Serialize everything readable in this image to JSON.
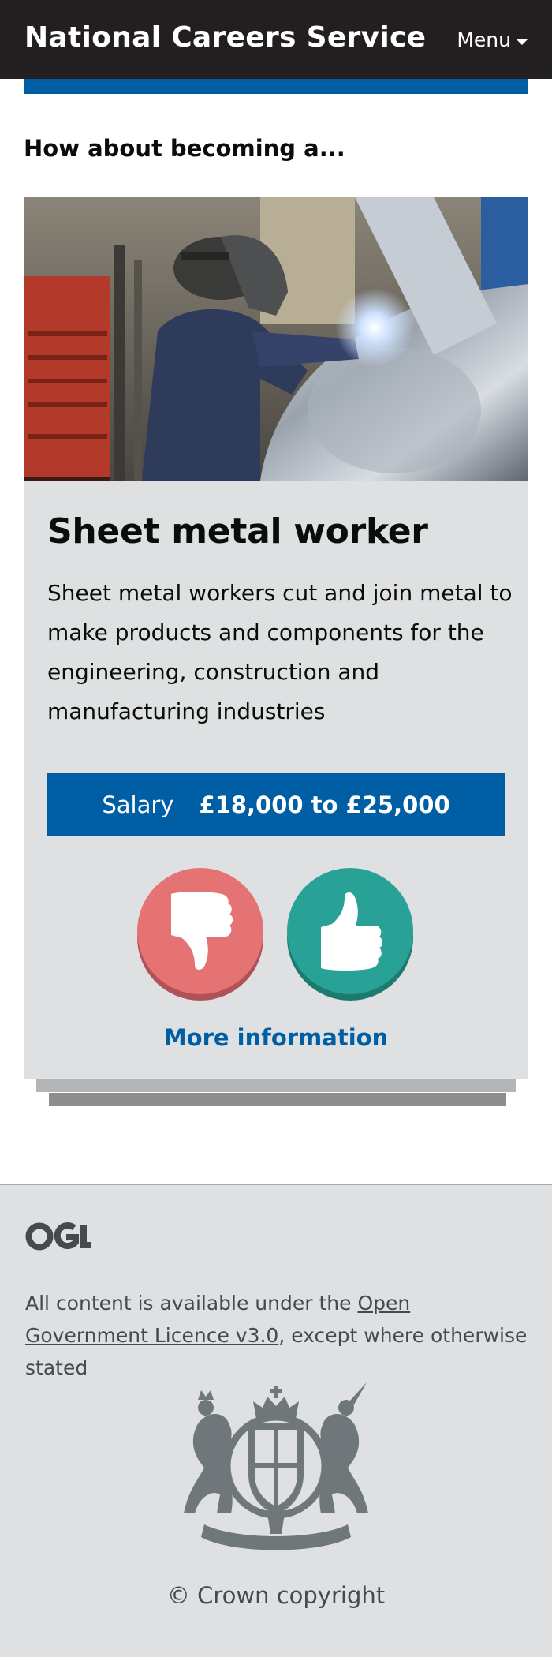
{
  "header": {
    "brand": "National Careers Service",
    "menu_label": "Menu"
  },
  "prompt": "How about becoming a...",
  "card": {
    "image_alt": "welder",
    "title": "Sheet metal worker",
    "description": "Sheet metal workers cut and join metal to make products and components for the engineering, construction and manufacturing industries",
    "salary_label": "Salary",
    "salary_value": "£18,000 to £25,000",
    "dislike_icon": "thumbs-down-icon",
    "like_icon": "thumbs-up-icon",
    "more_info": "More information"
  },
  "footer": {
    "logo_text": "OGL",
    "licence_prefix": "All content is available under the ",
    "licence_link": "Open Government Licence v3.0",
    "licence_suffix": ", except where otherwise stated",
    "crest_icon": "royal-coat-of-arms-icon",
    "copyright": "© Crown copyright"
  },
  "colors": {
    "header_bg": "#231f20",
    "brand_blue": "#005ea5",
    "card_bg": "#dee0e2",
    "dislike": "#e57373",
    "like": "#28a197",
    "footer_text": "#454a4d"
  }
}
